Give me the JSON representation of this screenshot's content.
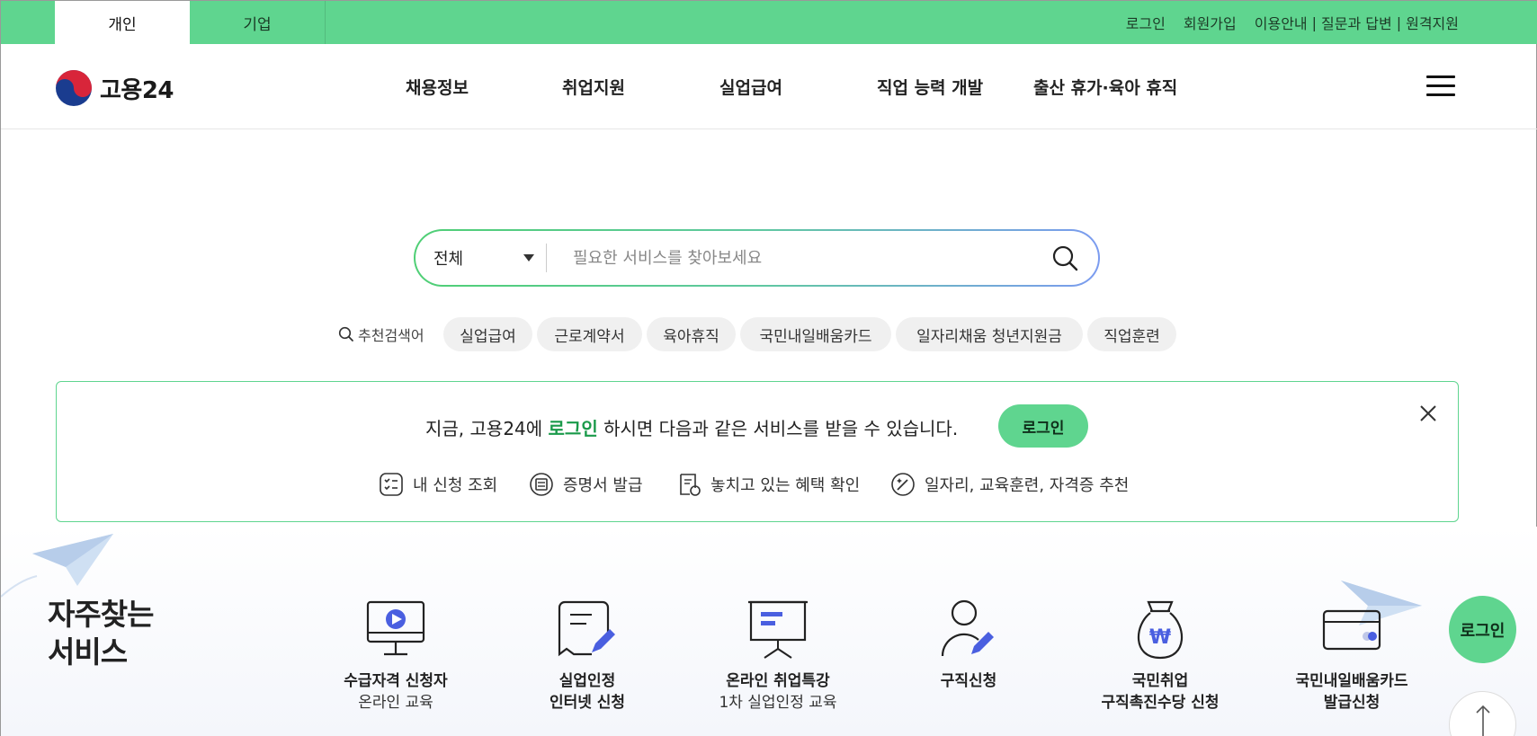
{
  "topbar": {
    "tabs": [
      {
        "label": "개인"
      },
      {
        "label": "기업"
      }
    ],
    "links": [
      {
        "label": "로그인"
      },
      {
        "label": "회원가입"
      },
      {
        "label": "이용안내"
      },
      {
        "label": "질문과 답변"
      },
      {
        "label": "원격지원"
      }
    ],
    "separator": "|"
  },
  "header": {
    "logo_text": "고용24",
    "nav": [
      {
        "label": "채용정보"
      },
      {
        "label": "취업지원"
      },
      {
        "label": "실업급여"
      },
      {
        "label": "직업 능력 개발"
      },
      {
        "label": "출산 휴가·육아 휴직"
      }
    ],
    "menu_icon": "hamburger-icon"
  },
  "search": {
    "scope_selected": "전체",
    "placeholder": "필요한 서비스를 찾아보세요",
    "value": ""
  },
  "suggested": {
    "label": "추천검색어",
    "keywords": [
      "실업급여",
      "근로계약서",
      "육아휴직",
      "국민내일배움카드",
      "일자리채움 청년지원금",
      "직업훈련"
    ]
  },
  "notice": {
    "msg_before": "지금, 고용24에 ",
    "msg_highlight": "로그인",
    "msg_after": " 하시면 다음과 같은 서비스를 받을 수 있습니다.",
    "login_button": "로그인",
    "benefits": [
      "내 신청 조회",
      "증명서 발급",
      "놓치고 있는 혜택 확인",
      "일자리, 교육훈련, 자격증 추천"
    ]
  },
  "frequent": {
    "title_line1": "자주찾는",
    "title_line2": "서비스",
    "services": [
      {
        "line1": "수급자격 신청자",
        "line2": "온라인 교육",
        "icon": "video-monitor-icon"
      },
      {
        "line1": "실업인정",
        "line2": "인터넷 신청",
        "icon": "document-pen-icon"
      },
      {
        "line1": "온라인 취업특강",
        "line2": "1차 실업인정 교육",
        "icon": "presentation-board-icon"
      },
      {
        "line1": "구직신청",
        "line2": "",
        "icon": "person-pen-icon"
      },
      {
        "line1": "국민취업",
        "line2": "구직촉진수당 신청",
        "icon": "money-bag-icon"
      },
      {
        "line1": "국민내일배움카드",
        "line2": "발급신청",
        "icon": "card-icon"
      }
    ]
  },
  "floating": {
    "login": "로그인",
    "top_icon": "arrow-up-icon"
  },
  "colors": {
    "brand_green": "#5fd58f",
    "highlight_green": "#1a9a4a",
    "accent_blue": "#4a5fe0"
  }
}
